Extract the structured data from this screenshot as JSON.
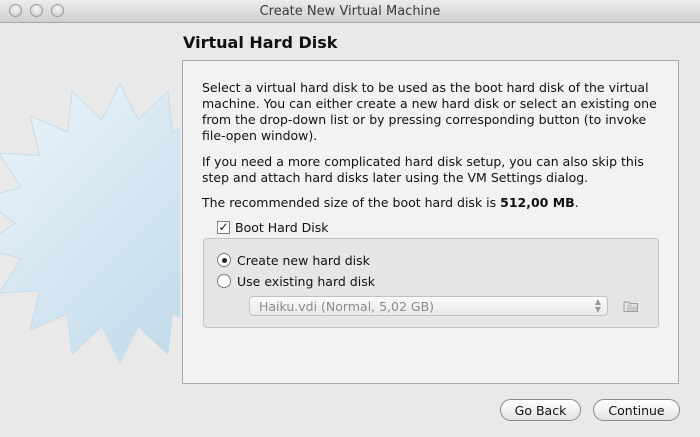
{
  "window": {
    "title": "Create New Virtual Machine"
  },
  "page": {
    "heading": "Virtual Hard Disk",
    "paragraph1": "Select a virtual hard disk to be used as the boot hard disk of the virtual machine. You can either create a new hard disk or select an existing one from the drop-down list or by pressing corresponding button (to invoke file-open window).",
    "paragraph2": "If you need a more complicated hard disk setup, you can also skip this step and attach hard disks later using the VM Settings dialog.",
    "recommended_prefix": "The recommended size of the boot hard disk is ",
    "recommended_size": "512,00 MB",
    "recommended_suffix": "."
  },
  "boot_disk": {
    "label": "Boot Hard Disk",
    "checked": true,
    "options": [
      {
        "label": "Create new hard disk",
        "selected": true
      },
      {
        "label": "Use existing hard disk",
        "selected": false
      }
    ],
    "existing_disk_value": "Haiku.vdi (Normal, 5,02 GB)"
  },
  "buttons": {
    "back": "Go Back",
    "continue": "Continue"
  }
}
